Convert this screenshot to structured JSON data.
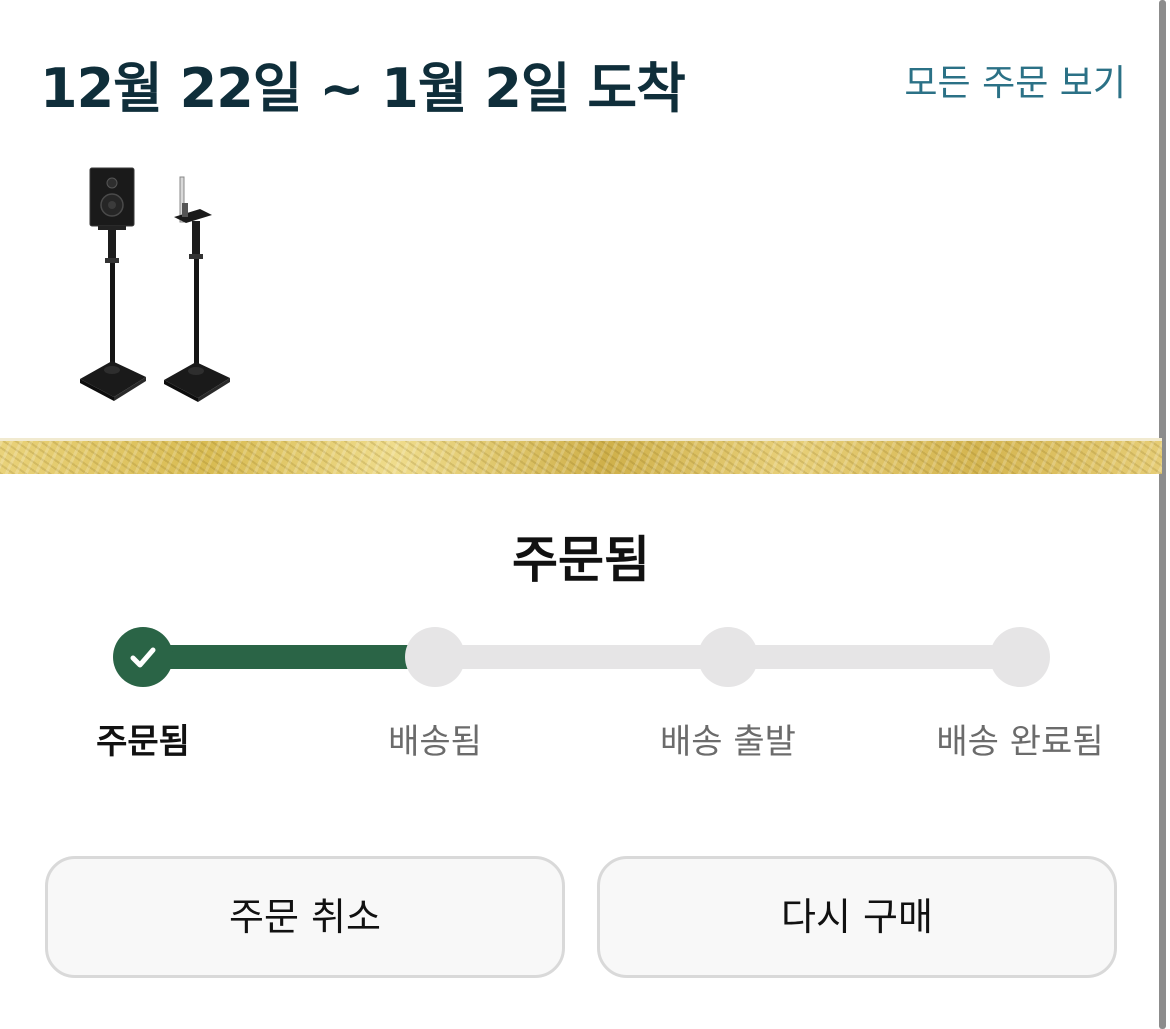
{
  "header": {
    "delivery_title": "12월 22일 ~ 1월 2일 도착",
    "view_all_orders": "모든 주문 보기"
  },
  "product": {
    "icon": "speaker-stand-pair-image"
  },
  "status": {
    "title": "주문됨",
    "progress": 0.33,
    "steps": [
      {
        "label": "주문됨",
        "done": true
      },
      {
        "label": "배송됨",
        "done": false
      },
      {
        "label": "배송 출발",
        "done": false
      },
      {
        "label": "배송 완료됨",
        "done": false
      }
    ]
  },
  "actions": {
    "cancel_order": "주문 취소",
    "buy_again": "다시 구매"
  },
  "colors": {
    "title": "#0f2e3a",
    "link": "#2b7186",
    "progress_fill": "#2a6446",
    "progress_track": "#e6e5e6",
    "gold_band": "#dcc15e"
  }
}
